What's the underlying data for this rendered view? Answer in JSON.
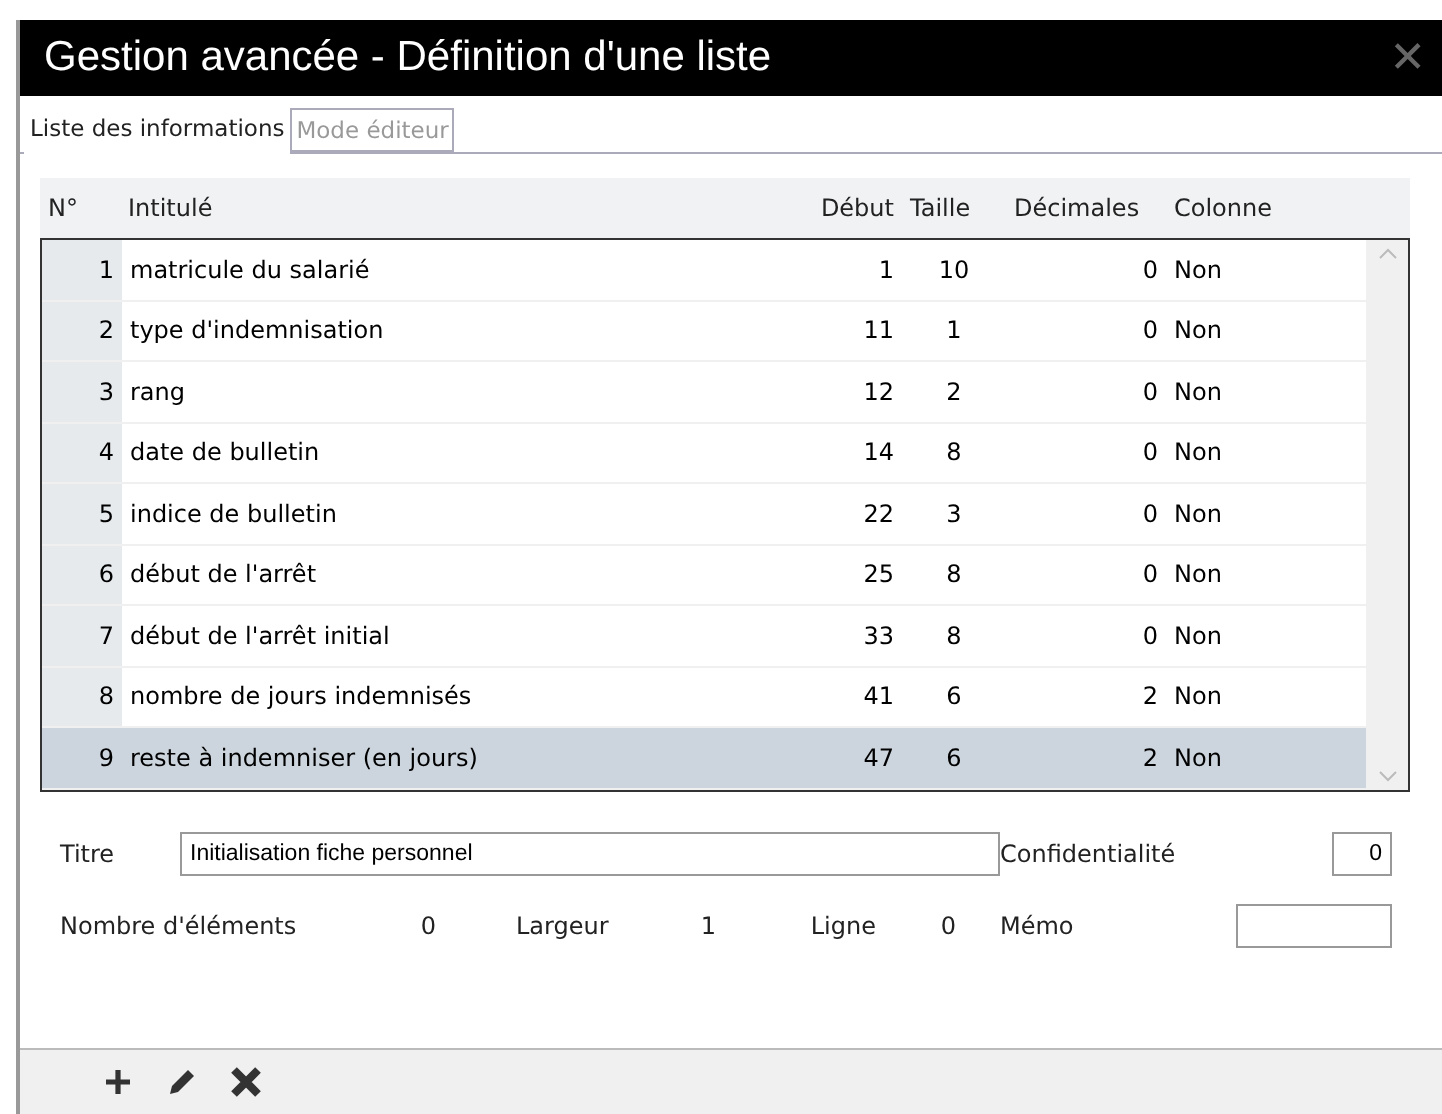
{
  "window": {
    "title": "Gestion avancée - Définition d'une liste",
    "close": "✕"
  },
  "tabs": [
    {
      "label": "Liste des informations",
      "selected": true
    },
    {
      "label": "Mode éditeur",
      "selected": false
    }
  ],
  "table": {
    "columns": [
      "N°",
      "Intitulé",
      "Début",
      "Taille",
      "Décimales",
      "Colonne"
    ],
    "rows": [
      {
        "cells": [
          "1",
          "matricule du salarié",
          "1",
          "10",
          "0",
          "Non"
        ],
        "selected": false
      },
      {
        "cells": [
          "2",
          "type d'indemnisation",
          "11",
          "1",
          "0",
          "Non"
        ],
        "selected": false
      },
      {
        "cells": [
          "3",
          "rang",
          "12",
          "2",
          "0",
          "Non"
        ],
        "selected": false
      },
      {
        "cells": [
          "4",
          "date de bulletin",
          "14",
          "8",
          "0",
          "Non"
        ],
        "selected": false
      },
      {
        "cells": [
          "5",
          "indice de bulletin",
          "22",
          "3",
          "0",
          "Non"
        ],
        "selected": false
      },
      {
        "cells": [
          "6",
          "début de l'arrêt",
          "25",
          "8",
          "0",
          "Non"
        ],
        "selected": false
      },
      {
        "cells": [
          "7",
          "début de l'arrêt initial",
          "33",
          "8",
          "0",
          "Non"
        ],
        "selected": false
      },
      {
        "cells": [
          "8",
          "nombre de jours indemnisés",
          "41",
          "6",
          "2",
          "Non"
        ],
        "selected": false
      },
      {
        "cells": [
          "9",
          "reste à indemniser (en jours)",
          "47",
          "6",
          "2",
          "Non"
        ],
        "selected": true
      }
    ]
  },
  "form": {
    "titre_label": "Titre",
    "titre_value": "Initialisation fiche personnel",
    "confidentialite_label": "Confidentialité",
    "confidentialite_value": "0",
    "nombre_label": "Nombre d'éléments",
    "nombre_value": "0",
    "largeur_label": "Largeur",
    "largeur_value": "1",
    "ligne_label": "Ligne",
    "ligne_value": "0",
    "memo_label": "Mémo"
  },
  "toolbar": [
    {
      "kind": "add"
    },
    {
      "kind": "edit"
    },
    {
      "kind": "delete"
    }
  ]
}
